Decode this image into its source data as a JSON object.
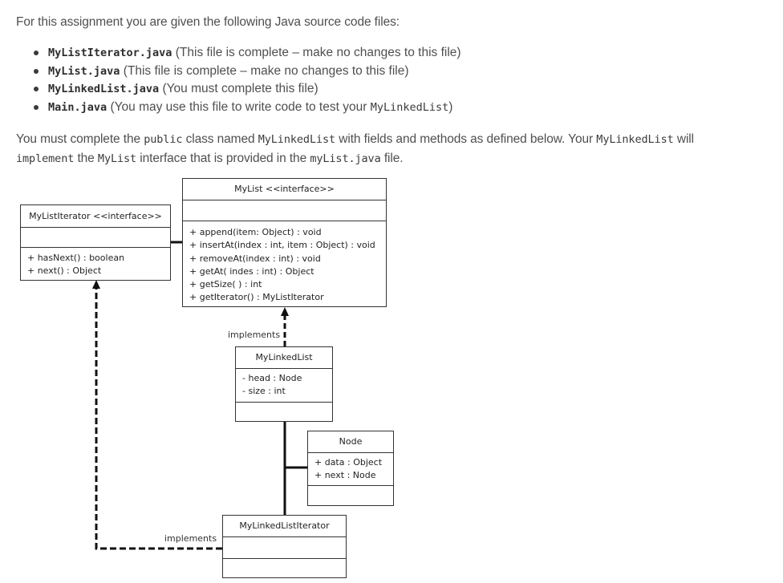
{
  "intro": "For this assignment you are given the following Java source code files:",
  "files": [
    {
      "name": "MyListIterator.java",
      "note": " (This file is complete – make no changes to this file)"
    },
    {
      "name": "MyList.java",
      "note": " (This file is complete – make no changes to this file)"
    },
    {
      "name": "MyLinkedList.java",
      "note": " (You must complete this file)"
    },
    {
      "name": "Main.java",
      "note": " (You may use this file to write code to test your ",
      "code_suffix": "MyLinkedList",
      "note_end": ")"
    }
  ],
  "instructions": {
    "t1": "You must complete the ",
    "c1": "public",
    "t2": " class named ",
    "c2": "MyLinkedList",
    "t3": " with fields and methods as defined below. Your ",
    "c3": "MyLinkedList",
    "t4": " will ",
    "c4": "implement",
    "t5": " the ",
    "c5": "MyList",
    "t6": " interface that is provided in the ",
    "c6": "myList.java",
    "t7": " file."
  },
  "uml": {
    "mylist": {
      "title": "MyList <<interface>>",
      "methods": [
        "+ append(item: Object) : void",
        "+ insertAt(index : int, item : Object) : void",
        "+ removeAt(index : int) : void",
        "+ getAt( indes : int) : Object",
        "+ getSize( ) : int",
        "+ getIterator() : MyListIterator"
      ]
    },
    "mylistiterator": {
      "title": "MyListIterator <<interface>>",
      "methods": [
        "+ hasNext() : boolean",
        "+ next() : Object"
      ]
    },
    "mylinkedlist": {
      "title": "MyLinkedList",
      "fields": [
        "- head : Node",
        "- size : int"
      ]
    },
    "node": {
      "title": "Node",
      "fields": [
        "+ data : Object",
        "+ next : Node"
      ]
    },
    "mylinkedlistiterator": {
      "title": "MyLinkedListIterator"
    },
    "implements_label_1": "implements",
    "implements_label_2": "implements"
  }
}
